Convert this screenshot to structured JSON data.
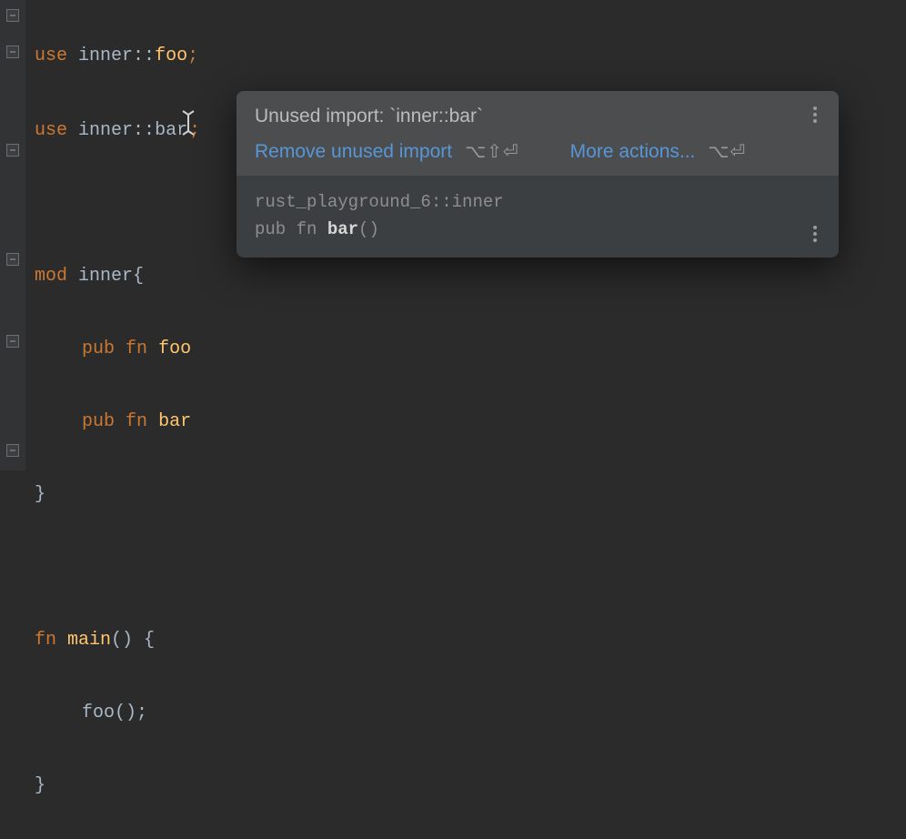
{
  "code": {
    "line1": {
      "kw": "use",
      "path1": "inner",
      "sep": "::",
      "name": "foo",
      "end": ";"
    },
    "line2": {
      "kw": "use",
      "path1": "inner",
      "sep": "::",
      "name": "bar",
      "end": ";"
    },
    "line4": {
      "kw": "mod",
      "name": "inner",
      "brace": "{"
    },
    "line5": {
      "vis": "pub",
      "kw": "fn",
      "name": "foo"
    },
    "line6": {
      "vis": "pub",
      "kw": "fn",
      "name": "bar"
    },
    "line7": {
      "brace": "}"
    },
    "line9": {
      "kw": "fn",
      "name": "main",
      "sig": "() {"
    },
    "line10": {
      "call": "foo",
      "tail": "();"
    },
    "line11": {
      "brace": "}"
    }
  },
  "popup": {
    "title": "Unused import: `inner::bar`",
    "action_remove": "Remove unused import",
    "shortcut1": "⌥⇧⏎",
    "action_more": "More actions...",
    "shortcut2": "⌥⏎",
    "doc_path": "rust_playground_6::inner",
    "doc_sig_kw": "pub fn ",
    "doc_sig_name": "bar",
    "doc_sig_tail": "()"
  }
}
